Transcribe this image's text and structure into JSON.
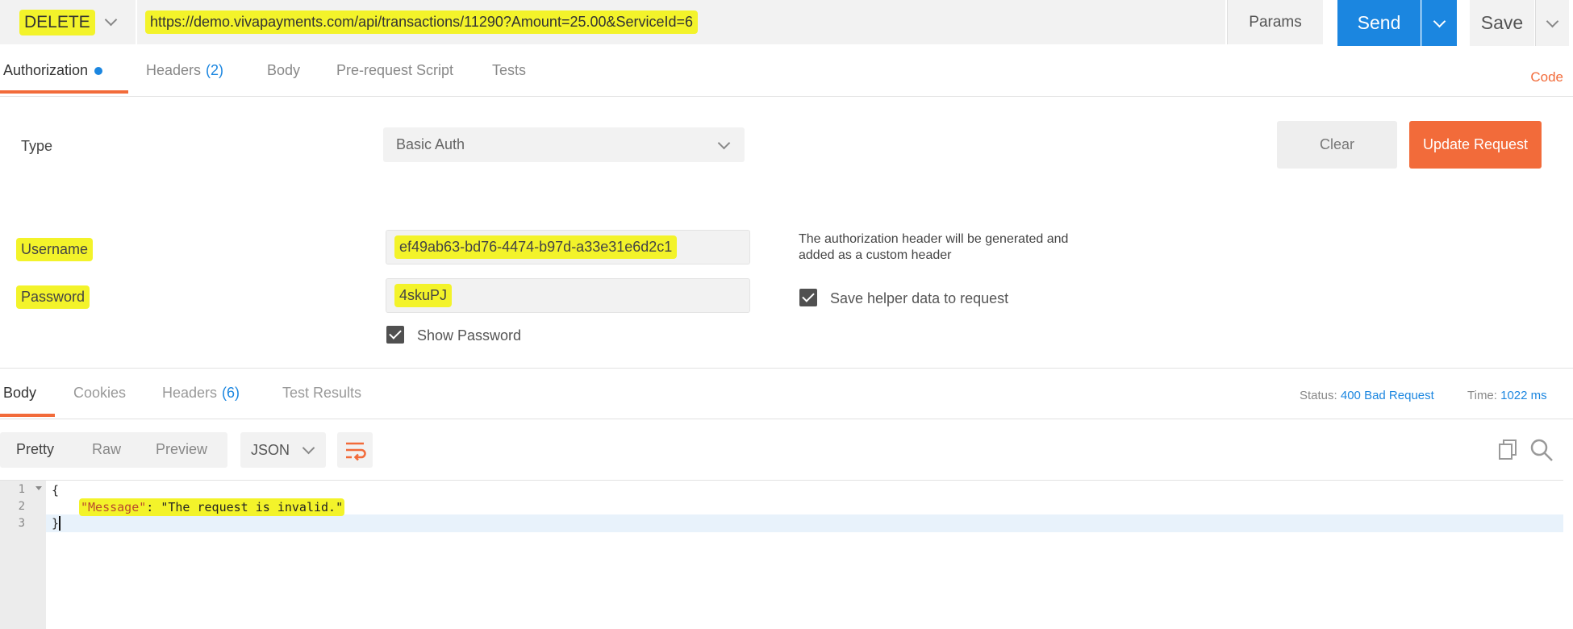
{
  "request": {
    "method": "DELETE",
    "url": "https://demo.vivapayments.com/api/transactions/11290?Amount=25.00&ServiceId=6",
    "params_label": "Params",
    "send_label": "Send",
    "save_label": "Save"
  },
  "request_tabs": [
    {
      "label": "Authorization",
      "count": "",
      "active": true
    },
    {
      "label": "Headers",
      "count": "(2)",
      "active": false
    },
    {
      "label": "Body",
      "count": "",
      "active": false
    },
    {
      "label": "Pre-request Script",
      "count": "",
      "active": false
    },
    {
      "label": "Tests",
      "count": "",
      "active": false
    }
  ],
  "code_link": "Code",
  "auth": {
    "type_label": "Type",
    "type_value": "Basic Auth",
    "clear_label": "Clear",
    "update_label": "Update Request",
    "username_label": "Username",
    "username_value": "ef49ab63-bd76-4474-b97d-a33e31e6d2c1",
    "password_label": "Password",
    "password_value": "4skuPJ",
    "show_password_label": "Show Password",
    "show_password_checked": true,
    "help_text": "The authorization header will be generated and added as a custom header",
    "save_helper_label": "Save helper data to request",
    "save_helper_checked": true
  },
  "response_tabs": [
    {
      "label": "Body",
      "count": "",
      "active": true
    },
    {
      "label": "Cookies",
      "count": "",
      "active": false
    },
    {
      "label": "Headers",
      "count": "(6)",
      "active": false
    },
    {
      "label": "Test Results",
      "count": "",
      "active": false
    }
  ],
  "status": {
    "status_label": "Status:",
    "status_value": "400 Bad Request",
    "time_label": "Time:",
    "time_value": "1022 ms"
  },
  "view_modes": [
    "Pretty",
    "Raw",
    "Preview"
  ],
  "active_view_mode": "Pretty",
  "format": "JSON",
  "icons": [
    "chevron-down-icon",
    "wrap-lines-icon",
    "copy-icon",
    "search-icon",
    "checkbox-checked-icon"
  ],
  "colors": {
    "accent_orange": "#f26b3a",
    "send_blue": "#1b86e0",
    "highlight_yellow": "#f3f32a"
  },
  "editor": {
    "line_numbers": [
      "1",
      "2",
      "3"
    ],
    "line1": "{",
    "key": "\"Message\"",
    "colon": ": ",
    "value": "\"The request is invalid.\"",
    "line3": "}"
  }
}
